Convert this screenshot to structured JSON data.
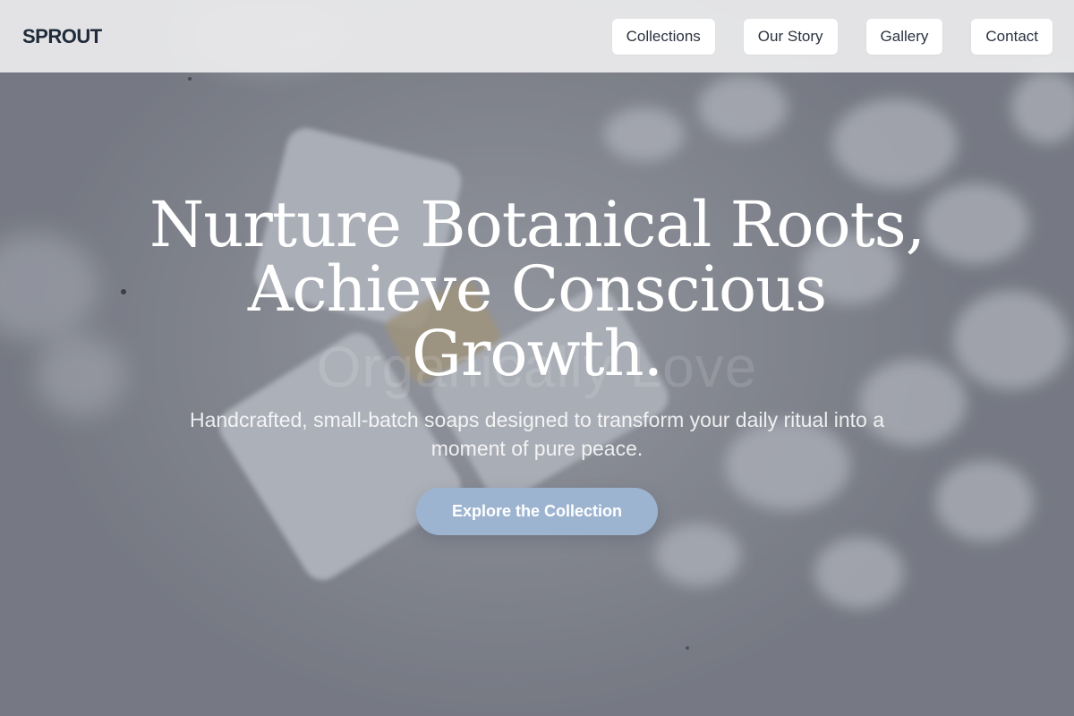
{
  "header": {
    "brand": "SPROUT",
    "nav": [
      {
        "label": "Collections"
      },
      {
        "label": "Our Story"
      },
      {
        "label": "Gallery"
      },
      {
        "label": "Contact"
      }
    ]
  },
  "hero": {
    "title_lines": [
      "Nurture Botanical Roots,",
      "Achieve Conscious",
      "Growth."
    ],
    "background_text": "Organically Love",
    "subtitle": "Handcrafted, small-batch soaps designed to transform your daily ritual into a moment of pure peace.",
    "cta_label": "Explore the Collection",
    "background_image": "soap-bars-photo"
  },
  "colors": {
    "accent": "#9db4d1",
    "brand_text": "#1f2a3a",
    "header_bg": "#ececee"
  }
}
